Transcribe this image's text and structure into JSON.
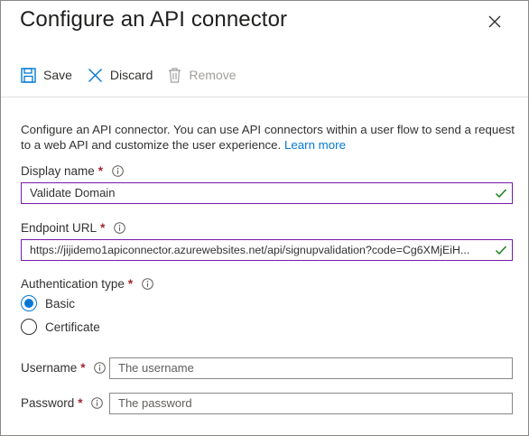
{
  "panel": {
    "title": "Configure an API connector"
  },
  "toolbar": {
    "save_label": "Save",
    "discard_label": "Discard",
    "remove_label": "Remove"
  },
  "description": {
    "text": "Configure an API connector. You can use API connectors within a user flow to send a request to a web API and customize the user experience. ",
    "link_text": "Learn more"
  },
  "display_name": {
    "label": "Display name",
    "required_mark": "*",
    "value": "Validate Domain"
  },
  "endpoint_url": {
    "label": "Endpoint URL",
    "required_mark": "*",
    "value": "https://jijidemo1apiconnector.azurewebsites.net/api/signupvalidation?code=Cg6XMjEiH..."
  },
  "auth_type": {
    "label": "Authentication type",
    "required_mark": "*",
    "options": [
      {
        "label": "Basic",
        "selected": true
      },
      {
        "label": "Certificate",
        "selected": false
      }
    ]
  },
  "username": {
    "label": "Username",
    "required_mark": "*",
    "placeholder": "The username"
  },
  "password": {
    "label": "Password",
    "required_mark": "*",
    "placeholder": "The password"
  },
  "colors": {
    "accent": "#0078d4",
    "required": "#a4262c",
    "valid_check": "#107c10",
    "focus_border": "#7719aa"
  }
}
